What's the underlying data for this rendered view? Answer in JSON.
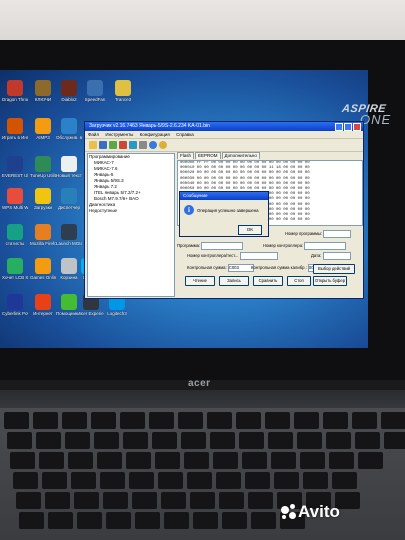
{
  "desktop": {
    "icons": [
      {
        "label": "Dragon Throne",
        "color": "#c0392b"
      },
      {
        "label": "КЛЮЧИ",
        "color": "#8e6a2a"
      },
      {
        "label": "Diablo2",
        "color": "#6b2a1a"
      },
      {
        "label": "SpeedFan",
        "color": "#3a6fb0"
      },
      {
        "label": "Trance3",
        "color": "#e0c040"
      },
      {
        "label": "Играть в Интернете",
        "color": "#d35400"
      },
      {
        "label": "AIMP3",
        "color": "#f39c12"
      },
      {
        "label": "Обслужив. водителя",
        "color": "#2c82c9"
      },
      {
        "label": "EVEREST Ultimate",
        "color": "#1f3f8f"
      },
      {
        "label": "TuneUp Utilities 2013",
        "color": "#2e8b57"
      },
      {
        "label": "Новый текстовый",
        "color": "#ecf0f1"
      },
      {
        "label": "WPS Multi Wariety",
        "color": "#e74c3c"
      },
      {
        "label": "Загрузки",
        "color": "#f1c40f"
      },
      {
        "label": "Диспетчер",
        "color": "#2980b9"
      },
      {
        "label": "статисты",
        "color": "#16a085"
      },
      {
        "label": "Mozilla Firefox",
        "color": "#e67e22"
      },
      {
        "label": "Launch MGtests",
        "color": "#2c3e50"
      },
      {
        "label": "Хочет LCB Shared",
        "color": "#27ae60"
      },
      {
        "label": "Games Online Beta",
        "color": "#f39c12"
      },
      {
        "label": "Корзина",
        "color": "#bdc3c7"
      },
      {
        "label": "Skype",
        "color": "#00aff0"
      },
      {
        "label": "Cyberlink PowerDVD 11",
        "color": "#1e3799"
      },
      {
        "label": "Интернет",
        "color": "#e84118"
      },
      {
        "label": "Помощник по обновлению",
        "color": "#44bd32"
      },
      {
        "label": "Acer Experience",
        "color": "#2f3640"
      },
      {
        "label": "Logitech3",
        "color": "#0097e6"
      }
    ]
  },
  "brand": {
    "name": "ASPIRE",
    "model": "ONE"
  },
  "window": {
    "title": "Загрузчик v2.16.7463 Январь-5/9S-2.6.234 KA-01.bin",
    "menu": [
      "Файл",
      "Инструменты",
      "Конфигурация",
      "Справка"
    ],
    "tree": [
      "Программирование",
      "  МИКАС-7",
      "  МИКАС-7.6",
      "  Январь-5",
      "  Январь 5/9S.3",
      "  Январь 7.2",
      "  ITEL январь 5/7.2/7.2+",
      "  Bosch M7.9.7/6+ BAO",
      "Диагностика",
      "Недоступные"
    ],
    "tabs": [
      "Flash",
      "EEPROM",
      "Дополнительно"
    ],
    "hex_rows": [
      "000000 FF FF 00 00 00 00 00 00 00 00 00 00 00 00 00 00",
      "000010 00 00 00 00 00 00 00 00 00 00 11 18 00 00 00 00",
      "000020 00 00 00 00 00 00 00 00 00 00 00 00 00 00 00 00",
      "000030 00 00 00 00 00 00 00 00 00 00 00 00 00 00 00 00",
      "000040 00 00 00 00 00 00 00 00 00 00 00 00 00 00 00 00",
      "000050 00 00 00 00 00 00 00 00 00 00 00 00 00 00 00 00",
      "000060 00 00 00 00 00 00 00 00 00 00 00 00 00 00 00 00",
      "000070 00 00 00 00 00 00 00 00 00 00 00 00 00 00 00 00",
      "000080 00 00 00 00 00 00 00 00 00 00 00 00 00 00 00 00",
      "000090 00 00 00 00 00 00 00 00 00 00 00 00 00 00 00 00",
      "0000A0 00 00 00 00 00 00 00 00 00 00 00 00 00 00 00 00",
      "0000B0 00 00 00 00 00 00 00 00 00 00 00 00 00 00 00 00"
    ],
    "fields": {
      "program_label": "Программа:",
      "controller_num_label": "Номер контроллера:",
      "program_num_label": "Номер программы:",
      "controller_num2_label": "Номер контроллера/тест...",
      "date_label": "Дата:",
      "checksum_label": "Контрольная сумма:",
      "checksum_value": "C003",
      "calib_checksum_label": "Контрольная сумма калибр.:",
      "checksum2_label": "Контрольная сумма калибр.:",
      "calib_value": "0000"
    },
    "buttons": {
      "read": "Чтение",
      "write": "Запись",
      "compare": "Сравнить",
      "stop": "Стоп",
      "open_buffer": "Открыть буфер",
      "save_log": "Выбор действий"
    },
    "dialog": {
      "title": "Сообщение",
      "message": "Операция успешно завершена",
      "ok": "OK"
    }
  },
  "laptop": {
    "logo": "acer"
  },
  "watermark": {
    "text": "Avito"
  }
}
